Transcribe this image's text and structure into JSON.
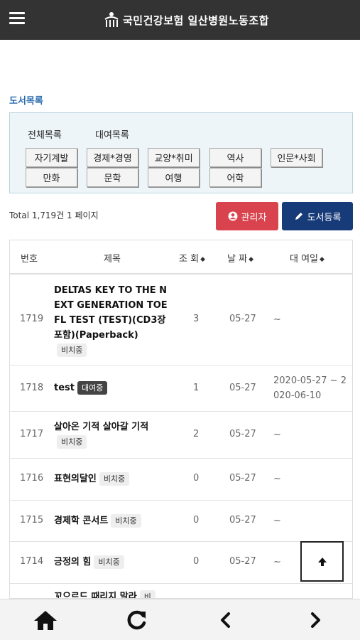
{
  "header": {
    "title": "국민건강보험 일산병원노동조합",
    "menu_icon": "hamburger-menu-icon",
    "logo_icon": "union-logo-icon"
  },
  "section_title": "도서목록",
  "categories": {
    "tabs": [
      "전체목록",
      "대여목록"
    ],
    "buttons_row1": [
      "자기계발",
      "경제*경영",
      "교양*취미",
      "역사",
      "인문*사회"
    ],
    "buttons_row2": [
      "만화",
      "문학",
      "여행",
      "어학"
    ]
  },
  "toolbar": {
    "total_text": "Total 1,719건 1 페이지",
    "admin_label": "관리자",
    "register_label": "도서등록",
    "admin_color": "#d9434e",
    "register_color": "#173a78"
  },
  "table": {
    "headers": [
      "번호",
      "제목",
      "조 회",
      "날 짜",
      "대 여일"
    ],
    "rows": [
      {
        "num": "1719",
        "title": "DELTAS KEY TO THE N EXT GENERATION TOE FL TEST (TEST)(CD3장 포함)(Paperback)",
        "badge": "비치중",
        "views": "3",
        "date": "05-27",
        "loan": "~"
      },
      {
        "num": "1718",
        "title": "test",
        "badge": "대여중",
        "views": "1",
        "date": "05-27",
        "loan": "2020-05-27 ~ 2020-06-10"
      },
      {
        "num": "1717",
        "title": "살아온 기적 살아갈 기적",
        "badge": "비치중",
        "views": "2",
        "date": "05-27",
        "loan": "~"
      },
      {
        "num": "1716",
        "title": "표현의달인",
        "badge": "비치중",
        "views": "0",
        "date": "05-27",
        "loan": "~"
      },
      {
        "num": "1715",
        "title": "경제학 콘서트",
        "badge": "비치중",
        "views": "0",
        "date": "05-27",
        "loan": "~"
      },
      {
        "num": "1714",
        "title": "긍정의 힘",
        "badge": "비치중",
        "views": "0",
        "date": "05-27",
        "loan": "~"
      },
      {
        "num": "",
        "title": "꼬으르드 때리지 말라",
        "badge": "비",
        "views": "",
        "date": "",
        "loan": ""
      }
    ]
  },
  "bottom_nav": [
    "home-icon",
    "refresh-icon",
    "back-icon",
    "forward-icon"
  ]
}
